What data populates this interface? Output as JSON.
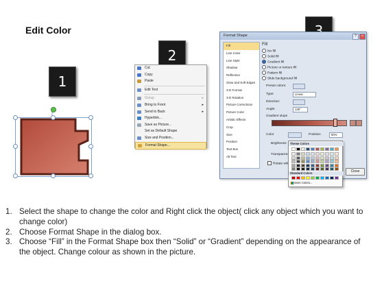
{
  "heading": "Edit Color",
  "badges": [
    "1",
    "2",
    "3"
  ],
  "shape": {
    "fill": "#c76655",
    "border": "#6f2a1f"
  },
  "context_menu": {
    "items": [
      {
        "label": "Cut",
        "icon": "scissors-icon",
        "color": "#4a76c5"
      },
      {
        "label": "Copy",
        "icon": "copy-icon",
        "color": "#4a76c5"
      },
      {
        "label": "Paste",
        "icon": "paste-icon",
        "color": "#c79a3d"
      },
      {
        "label": "Edit Text",
        "icon": "edit-text-icon",
        "color": "#6c8fc7"
      },
      {
        "label": "Group",
        "icon": "group-icon",
        "color": "#8a9bb4",
        "submenu": true
      },
      {
        "label": "Bring to Front",
        "icon": "bring-front-icon",
        "color": "#6c8fc7",
        "submenu": true
      },
      {
        "label": "Send to Back",
        "icon": "send-back-icon",
        "color": "#6c8fc7",
        "submenu": true
      },
      {
        "label": "Hyperlink...",
        "icon": "hyperlink-icon",
        "color": "#3b7dc0"
      },
      {
        "label": "Save as Picture...",
        "icon": "save-picture-icon",
        "color": "#9aa5b3"
      },
      {
        "label": "Set as Default Shape",
        "icon": "",
        "color": ""
      },
      {
        "label": "Size and Position...",
        "icon": "size-position-icon",
        "color": "#6c8fc7"
      },
      {
        "label": "Format Shape...",
        "icon": "format-shape-icon",
        "color": "#d8a23a",
        "highlighted": true
      }
    ]
  },
  "dialog": {
    "title": "Format Shape",
    "help": "?",
    "close": "×",
    "nav": [
      "Fill",
      "Line Color",
      "Line Style",
      "Shadow",
      "Reflection",
      "Glow and Soft Edges",
      "3-D Format",
      "3-D Rotation",
      "Picture Corrections",
      "Picture Color",
      "Artistic Effects",
      "Crop",
      "Size",
      "Position",
      "Text Box",
      "Alt Text"
    ],
    "section": "Fill",
    "fill_options": [
      {
        "label": "No fill",
        "selected": false
      },
      {
        "label": "Solid fill",
        "selected": false
      },
      {
        "label": "Gradient fill",
        "selected": true
      },
      {
        "label": "Picture or texture fill",
        "selected": false
      },
      {
        "label": "Pattern fill",
        "selected": false
      }
    ],
    "slide_bg": "Slide background fill",
    "preset_label": "Preset colors:",
    "type_label": "Type:",
    "type_value": "Linear",
    "direction_label": "Direction:",
    "angle_label": "Angle:",
    "angle_value": "135°",
    "stops_label": "Gradient stops",
    "color_label": "Color",
    "position_label": "Position:",
    "position_value": "80%",
    "brightness_label": "Brightness",
    "transparency_label": "Transparency",
    "rotate_label": "Rotate with shape",
    "close_button": "Close"
  },
  "color_popup": {
    "theme_header": "Theme Colors",
    "standard_header": "Standard Colors",
    "more": "More Colors...",
    "theme_top": [
      "#ffffff",
      "#000000",
      "#eeece1",
      "#1f497d",
      "#4f81bd",
      "#c0504d",
      "#9bbb59",
      "#8064a2",
      "#4bacc6",
      "#f79646"
    ],
    "theme_tints": [
      [
        "#f2f2f2",
        "#7f7f7f",
        "#ddd9c3",
        "#c6d9f0",
        "#dbe5f1",
        "#f2dcdb",
        "#ebf1dd",
        "#e5e0ec",
        "#dbeef3",
        "#fdeada"
      ],
      [
        "#d8d8d8",
        "#595959",
        "#c4bd97",
        "#8db3e2",
        "#b8cce4",
        "#e5b9b7",
        "#d7e3bc",
        "#ccc1d9",
        "#b7dde8",
        "#fbd5b5"
      ],
      [
        "#bfbfbf",
        "#3f3f3f",
        "#938953",
        "#548dd4",
        "#95b3d7",
        "#d99694",
        "#c3d69b",
        "#b2a2c7",
        "#92cddc",
        "#fac08f"
      ],
      [
        "#a5a5a5",
        "#262626",
        "#494429",
        "#17365d",
        "#366092",
        "#953734",
        "#76923c",
        "#5f497a",
        "#31859b",
        "#e36c09"
      ],
      [
        "#7f7f7f",
        "#0c0c0c",
        "#1d1b10",
        "#0f243e",
        "#244061",
        "#632423",
        "#4f6128",
        "#3f3151",
        "#205867",
        "#974806"
      ]
    ],
    "standard": [
      "#c00000",
      "#ff0000",
      "#ffc000",
      "#ffff00",
      "#92d050",
      "#00b050",
      "#00b0f0",
      "#0070c0",
      "#002060",
      "#7030a0"
    ]
  },
  "instructions": [
    {
      "num": "1.",
      "text": "Select the shape to change the color and Right click the object( click any object which you want to change color)"
    },
    {
      "num": "2.",
      "text": "Choose Format Shape in the dialog box."
    },
    {
      "num": "3.",
      "text": "Choose “Fill” in the Format Shape box then “Solid” or “Gradient” depending on the appearance of the object. Change colour as shown in the picture."
    }
  ]
}
